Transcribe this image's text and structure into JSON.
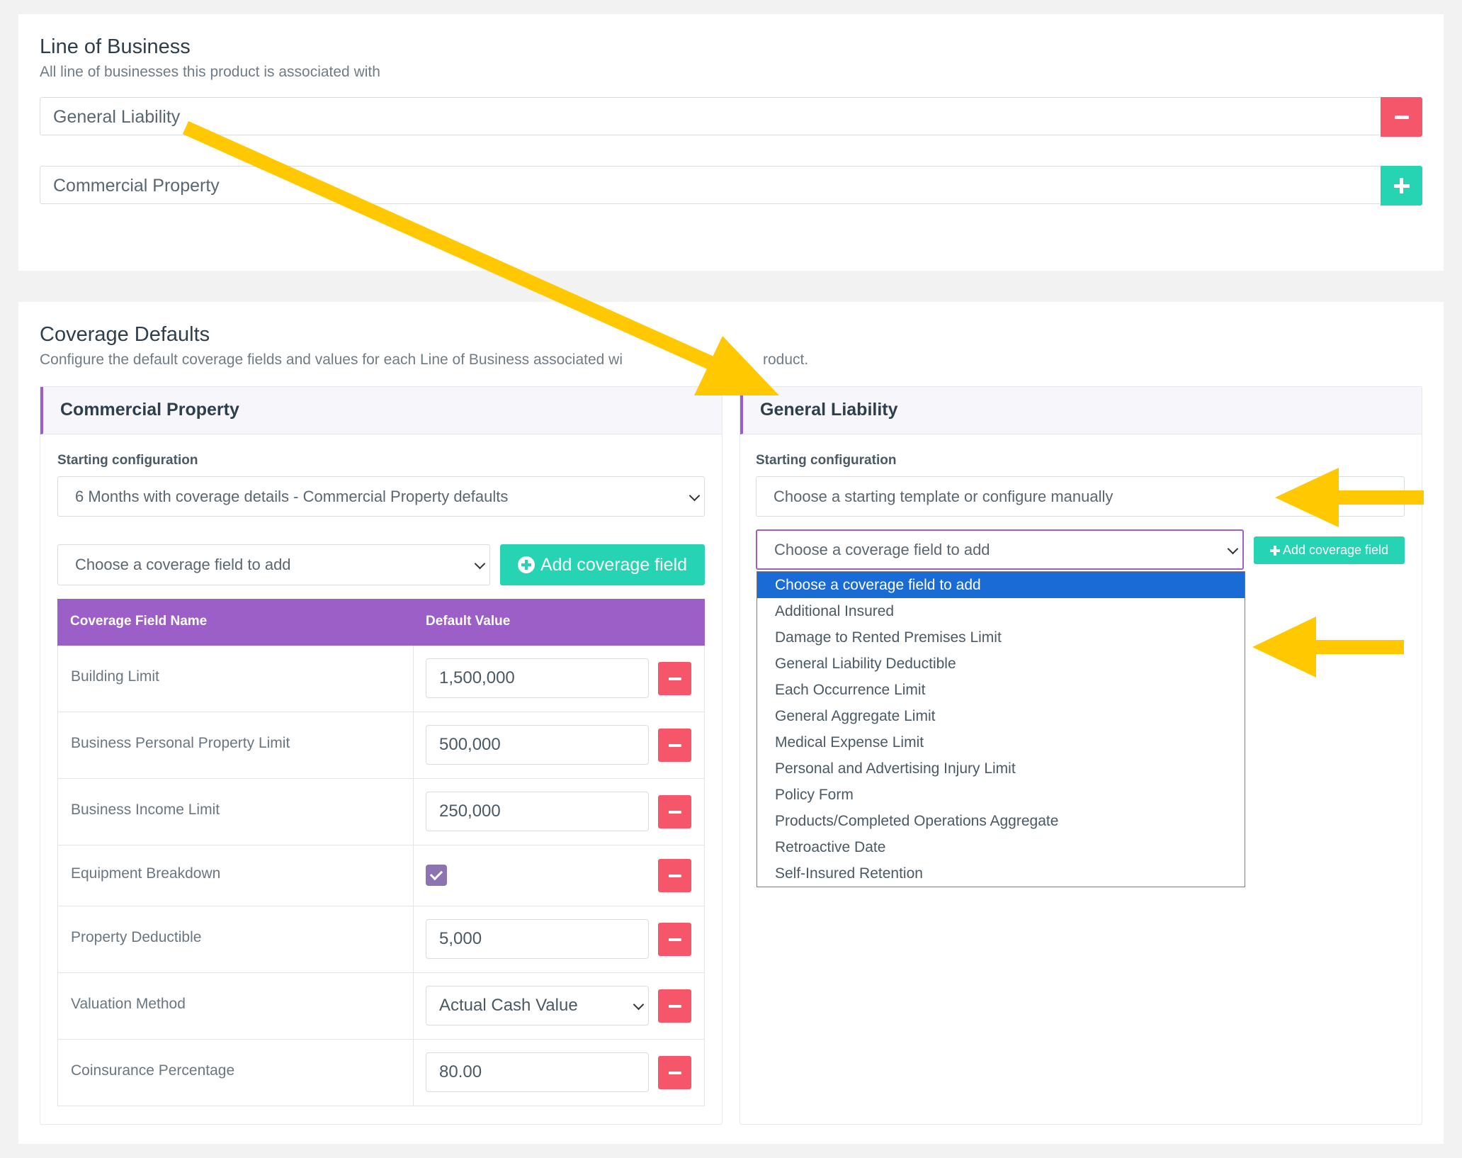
{
  "line_of_business": {
    "title": "Line of Business",
    "subtitle": "All line of businesses this product is associated with",
    "items": [
      {
        "label": "General Liability",
        "action": "remove"
      },
      {
        "label": "Commercial Property",
        "action": "add"
      }
    ]
  },
  "coverage_defaults": {
    "title": "Coverage Defaults",
    "subtitle_left": "Configure the default coverage fields and values for each Line of Business associated wi",
    "subtitle_right": "roduct.",
    "left_panel": {
      "title": "Commercial Property",
      "starting_label": "Starting configuration",
      "starting_value": "6 Months with coverage details - Commercial Property defaults",
      "field_select": "Choose a coverage field to add",
      "add_button": "Add coverage field",
      "table": {
        "headers": [
          "Coverage Field Name",
          "Default Value"
        ],
        "rows": [
          {
            "name": "Building Limit",
            "value": "1,500,000",
            "type": "text"
          },
          {
            "name": "Business Personal Property Limit",
            "value": "500,000",
            "type": "text"
          },
          {
            "name": "Business Income Limit",
            "value": "250,000",
            "type": "text"
          },
          {
            "name": "Equipment Breakdown",
            "value": "",
            "type": "checkbox"
          },
          {
            "name": "Property Deductible",
            "value": "5,000",
            "type": "text"
          },
          {
            "name": "Valuation Method",
            "value": "Actual Cash Value",
            "type": "select"
          },
          {
            "name": "Coinsurance Percentage",
            "value": "80.00",
            "type": "text"
          }
        ]
      }
    },
    "right_panel": {
      "title": "General Liability",
      "starting_label": "Starting configuration",
      "starting_placeholder": "Choose a starting template or configure manually",
      "field_select": "Choose a coverage field to add",
      "add_button": "Add coverage field",
      "dropdown_options": [
        "Choose a coverage field to add",
        "Additional Insured",
        "Damage to Rented Premises Limit",
        "General Liability Deductible",
        "Each Occurrence Limit",
        "General Aggregate Limit",
        "Medical Expense Limit",
        "Personal and Advertising Injury Limit",
        "Policy Form",
        "Products/Completed Operations Aggregate",
        "Retroactive Date",
        "Self-Insured Retention"
      ]
    }
  },
  "colors": {
    "accent_purple": "#9b5fc7",
    "add_teal": "#26d3b3",
    "remove_red": "#f6566a",
    "selected_blue": "#1a6bd6",
    "annotation_yellow": "#ffc800"
  }
}
